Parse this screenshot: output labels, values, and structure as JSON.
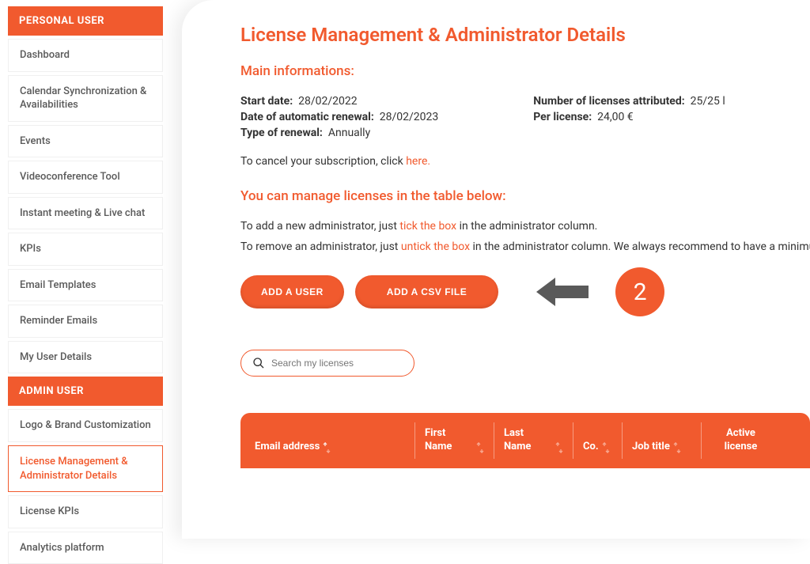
{
  "sidebar": {
    "personal_header": "PERSONAL USER",
    "personal_items": [
      "Dashboard",
      "Calendar Synchronization & Availabilities",
      "Events",
      "Videoconference Tool",
      "Instant meeting & Live chat",
      "KPIs",
      "Email Templates",
      "Reminder Emails",
      "My User Details"
    ],
    "admin_header": "ADMIN USER",
    "admin_items": [
      {
        "label": "Logo & Brand Customization",
        "active": false
      },
      {
        "label": "License Management & Administrator Details",
        "active": true
      },
      {
        "label": "License KPIs",
        "active": false
      },
      {
        "label": "Analytics platform",
        "active": false
      }
    ]
  },
  "page_title": "License Management & Administrator Details",
  "main_info": {
    "title": "Main informations:",
    "start_date_label": "Start date:",
    "start_date_value": "28/02/2022",
    "renewal_date_label": "Date of automatic renewal:",
    "renewal_date_value": "28/02/2023",
    "renewal_type_label": "Type of renewal:",
    "renewal_type_value": "Annually",
    "licenses_label": "Number of licenses attributed:",
    "licenses_value": "25/25 l",
    "per_license_label": "Per license:",
    "per_license_value": "24,00 €"
  },
  "cancel": {
    "prefix": "To cancel your subscription, click ",
    "link": "here."
  },
  "manage": {
    "title": "You can manage licenses in the table below:",
    "add_admin_prefix": "To add a new administrator, just ",
    "add_admin_highlight": "tick the box",
    "add_admin_suffix": " in the administrator column.",
    "remove_admin_prefix": "To remove an administrator, just ",
    "remove_admin_highlight": "untick the box",
    "remove_admin_suffix": " in the administrator column. We always recommend to have a minimu"
  },
  "buttons": {
    "add_user": "ADD A USER",
    "add_csv": "ADD A CSV FILE"
  },
  "step_badge": "2",
  "search_placeholder": "Search my licenses",
  "table": {
    "email": "Email address",
    "first": "First Name",
    "last": "Last Name",
    "co": "Co.",
    "job": "Job title",
    "active": "Active license"
  }
}
